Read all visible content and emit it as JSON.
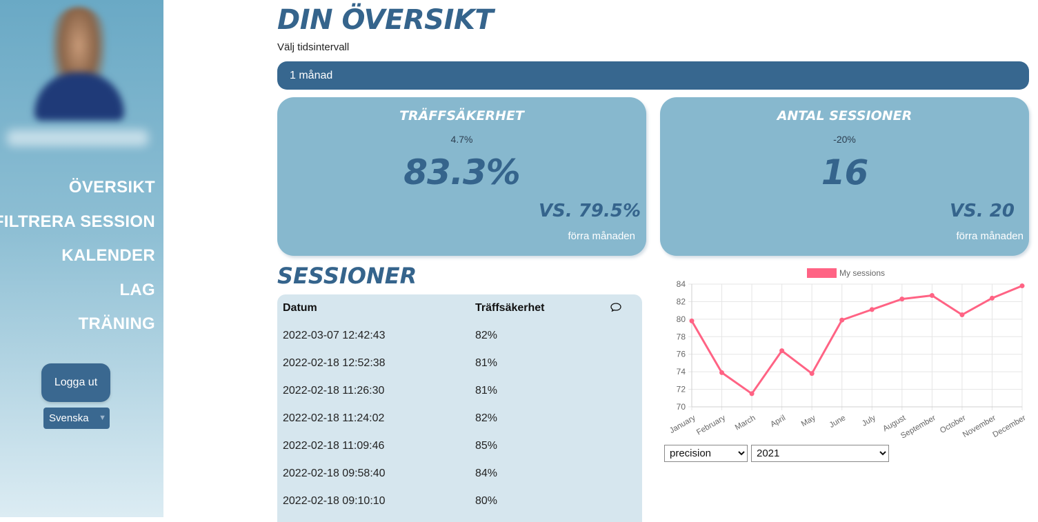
{
  "nav": {
    "items": [
      "ÖVERSIKT",
      "FILTRERA SESSION",
      "KALENDER",
      "LAG",
      "TRÄNING"
    ],
    "logout": "Logga ut",
    "language": "Svenska"
  },
  "header": {
    "title": "DIN ÖVERSIKT",
    "subtitle": "Välj tidsintervall",
    "interval": "1 månad"
  },
  "cards": [
    {
      "title": "TRÄFFSÄKERHET",
      "delta": "4.7%",
      "value": "83.3%",
      "vs": "VS. 79.5%",
      "period": "förra månaden"
    },
    {
      "title": "ANTAL SESSIONER",
      "delta": "-20%",
      "value": "16",
      "vs": "VS. 20",
      "period": "förra månaden"
    }
  ],
  "sessions": {
    "title": "SESSIONER",
    "headers": {
      "date": "Datum",
      "accuracy": "Träffsäkerhet"
    },
    "rows": [
      {
        "date": "2022-03-07 12:42:43",
        "accuracy": "82%"
      },
      {
        "date": "2022-02-18 12:52:38",
        "accuracy": "81%"
      },
      {
        "date": "2022-02-18 11:26:30",
        "accuracy": "81%"
      },
      {
        "date": "2022-02-18 11:24:02",
        "accuracy": "82%"
      },
      {
        "date": "2022-02-18 11:09:46",
        "accuracy": "85%"
      },
      {
        "date": "2022-02-18 09:58:40",
        "accuracy": "84%"
      },
      {
        "date": "2022-02-18 09:10:10",
        "accuracy": "80%"
      }
    ]
  },
  "selects": {
    "metric": {
      "value": "precision",
      "options": [
        "precision"
      ]
    },
    "year": {
      "value": "2021",
      "options": [
        "2021"
      ]
    }
  },
  "chart_data": {
    "type": "line",
    "title": "",
    "xlabel": "",
    "ylabel": "",
    "x": [
      "January",
      "February",
      "March",
      "April",
      "May",
      "June",
      "July",
      "August",
      "September",
      "October",
      "November",
      "December"
    ],
    "series": [
      {
        "name": "My sessions",
        "color": "#ff6384",
        "values": [
          79.8,
          73.9,
          71.5,
          76.4,
          73.8,
          79.9,
          81.1,
          82.3,
          82.7,
          80.5,
          82.4,
          83.8
        ]
      }
    ],
    "ylim": [
      70,
      84
    ],
    "yticks": [
      70,
      72,
      74,
      76,
      78,
      80,
      82,
      84
    ],
    "grid": true,
    "legend": "top"
  },
  "colors": {
    "accent": "#35648c",
    "card": "#87b8ce",
    "line": "#ff6384"
  }
}
